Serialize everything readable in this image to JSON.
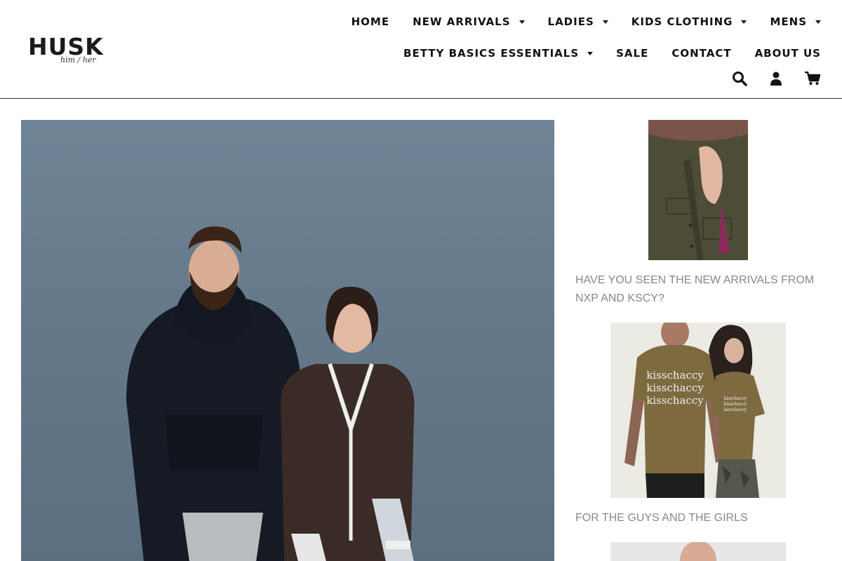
{
  "brand": {
    "name": "HUSK",
    "tagline": "him / her"
  },
  "nav": {
    "row1": [
      {
        "label": "HOME",
        "dropdown": false
      },
      {
        "label": "NEW ARRIVALS",
        "dropdown": true
      },
      {
        "label": "LADIES",
        "dropdown": true
      },
      {
        "label": "KIDS CLOTHING",
        "dropdown": true
      },
      {
        "label": "MENS",
        "dropdown": true
      }
    ],
    "row2": [
      {
        "label": "BETTY BASICS ESSENTIALS",
        "dropdown": true
      },
      {
        "label": "SALE",
        "dropdown": false
      },
      {
        "label": "CONTACT",
        "dropdown": false
      },
      {
        "label": "ABOUT US",
        "dropdown": false
      }
    ]
  },
  "header_icons": [
    "search-icon",
    "account-icon",
    "cart-icon"
  ],
  "sidebar": {
    "posts": [
      {
        "title": "HAVE YOU SEEN THE NEW ARRIVALS FROM NXP AND KSCY?"
      },
      {
        "title": "FOR THE GUYS AND THE GIRLS",
        "shirt_text": "kisschaccy"
      }
    ]
  },
  "colors": {
    "text": "#111111",
    "muted": "#888888",
    "hero_bg": "#667a8b",
    "olive": "#7a6a3a"
  }
}
